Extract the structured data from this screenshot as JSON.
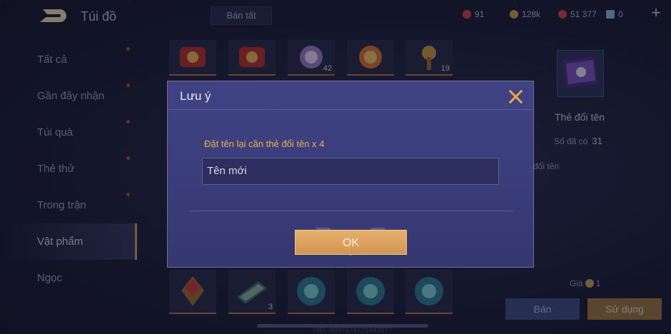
{
  "header": {
    "title": "Túi đồ",
    "sell_all_label": "Bán tất",
    "currencies": [
      {
        "icon": "red-gem-icon",
        "value": "91",
        "color": "#c94a44"
      },
      {
        "icon": "gold-coin-icon",
        "value": "128k",
        "color": "#c9a24a"
      },
      {
        "icon": "red-coupon-icon",
        "value": "51 377",
        "color": "#c94a44"
      },
      {
        "icon": "blue-voucher-icon",
        "value": "0",
        "color": "#8ab2d8"
      }
    ],
    "add_label": "+"
  },
  "sidebar": {
    "items": [
      {
        "label": "Tất cả",
        "has_dot": true
      },
      {
        "label": "Gần đây nhận",
        "has_dot": true
      },
      {
        "label": "Túi quà",
        "has_dot": true
      },
      {
        "label": "Thẻ thử",
        "has_dot": true
      },
      {
        "label": "Trong trận",
        "has_dot": true
      },
      {
        "label": "Vật phẩm",
        "has_dot": false,
        "active": true
      },
      {
        "label": "Ngọc",
        "has_dot": false
      }
    ]
  },
  "grid": {
    "top_row": [
      {
        "icon": "red-scroll-icon",
        "qty": ""
      },
      {
        "icon": "red-scroll-icon",
        "qty": ""
      },
      {
        "icon": "purple-orb-icon",
        "qty": "42"
      },
      {
        "icon": "orange-orb-icon",
        "qty": ""
      },
      {
        "icon": "gold-key-icon",
        "qty": "19"
      }
    ],
    "bottom_row": [
      {
        "icon": "red-crystal-emblem-icon",
        "qty": ""
      },
      {
        "icon": "map-scroll-icon",
        "qty": "3"
      },
      {
        "icon": "cyan-swirl-icon",
        "qty": ""
      },
      {
        "icon": "cyan-swirl-icon",
        "qty": ""
      },
      {
        "icon": "cyan-swirl-icon",
        "qty": ""
      }
    ]
  },
  "detail": {
    "name": "Thẻ đổi tên",
    "owned_label": "Số đã có",
    "owned_value": "31",
    "desc_fragment": "đổi tên",
    "price_label": "Giá",
    "price_value": "1",
    "sell_label": "Bán",
    "use_label": "Sử dụng"
  },
  "footer": {
    "uid_text": "UID: 6097374121843577"
  },
  "modal": {
    "title": "Lưu ý",
    "message": "Đặt tên lại cần thẻ đổi tên x 4",
    "input_value": "Tên mới",
    "ok_label": "OK"
  }
}
